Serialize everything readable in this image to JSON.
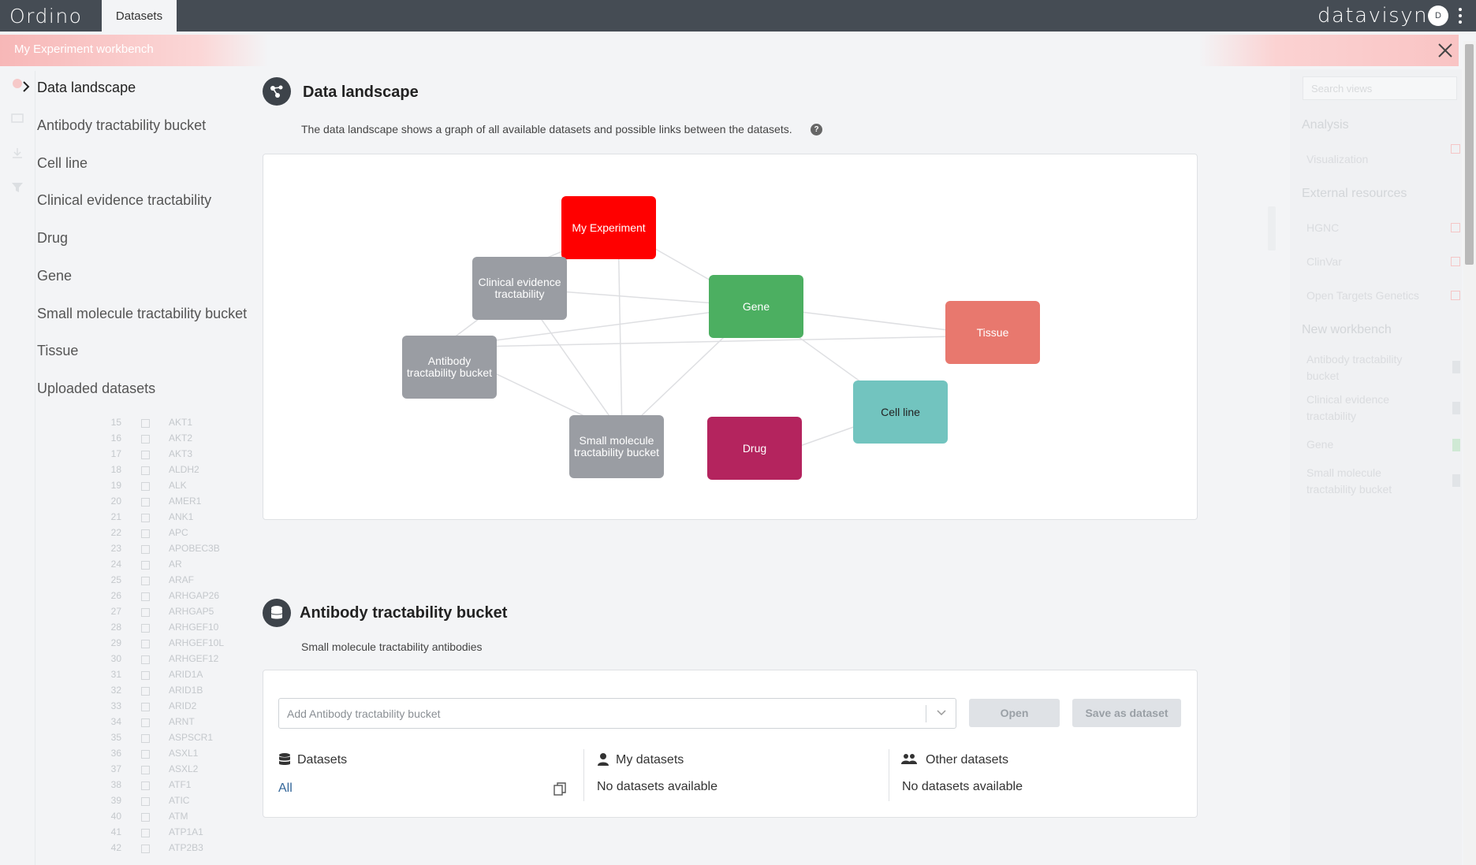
{
  "topbar": {
    "logo": "Ordino",
    "tab": "Datasets",
    "brand": "datavisyn",
    "avatar": "D"
  },
  "workbench": {
    "title": "My Experiment workbench"
  },
  "nav": {
    "items": [
      {
        "label": "Data landscape",
        "active": true
      },
      {
        "label": "Antibody tractability bucket"
      },
      {
        "label": "Cell line"
      },
      {
        "label": "Clinical evidence tractability"
      },
      {
        "label": "Drug"
      },
      {
        "label": "Gene"
      },
      {
        "label": "Small molecule tractability bucket"
      },
      {
        "label": "Tissue"
      },
      {
        "label": "Uploaded datasets"
      }
    ]
  },
  "background_rows": [
    {
      "num": "15",
      "sym": "AKT1"
    },
    {
      "num": "16",
      "sym": "AKT2"
    },
    {
      "num": "17",
      "sym": "AKT3"
    },
    {
      "num": "18",
      "sym": "ALDH2"
    },
    {
      "num": "19",
      "sym": "ALK"
    },
    {
      "num": "20",
      "sym": "AMER1"
    },
    {
      "num": "21",
      "sym": "ANK1"
    },
    {
      "num": "22",
      "sym": "APC"
    },
    {
      "num": "23",
      "sym": "APOBEC3B"
    },
    {
      "num": "24",
      "sym": "AR"
    },
    {
      "num": "25",
      "sym": "ARAF"
    },
    {
      "num": "26",
      "sym": "ARHGAP26"
    },
    {
      "num": "27",
      "sym": "ARHGAP5"
    },
    {
      "num": "28",
      "sym": "ARHGEF10"
    },
    {
      "num": "29",
      "sym": "ARHGEF10L"
    },
    {
      "num": "30",
      "sym": "ARHGEF12"
    },
    {
      "num": "31",
      "sym": "ARID1A"
    },
    {
      "num": "32",
      "sym": "ARID1B"
    },
    {
      "num": "33",
      "sym": "ARID2"
    },
    {
      "num": "34",
      "sym": "ARNT"
    },
    {
      "num": "35",
      "sym": "ASPSCR1"
    },
    {
      "num": "36",
      "sym": "ASXL1"
    },
    {
      "num": "37",
      "sym": "ASXL2"
    },
    {
      "num": "38",
      "sym": "ATF1"
    },
    {
      "num": "39",
      "sym": "ATIC"
    },
    {
      "num": "40",
      "sym": "ATM"
    },
    {
      "num": "41",
      "sym": "ATP1A1"
    },
    {
      "num": "42",
      "sym": "ATP2B3"
    }
  ],
  "right_panel": {
    "search_placeholder": "Search views",
    "analysis": "Analysis",
    "visualization": "Visualization",
    "external_resources": "External resources",
    "hgnc": "HGNC",
    "clinvar": "ClinVar",
    "open_targets": "Open Targets Genetics",
    "new_workbench": "New workbench",
    "nw_items": [
      "Antibody tractability bucket",
      "Clinical evidence tractability",
      "Gene",
      "Small molecule tractability bucket"
    ]
  },
  "landscape": {
    "title": "Data landscape",
    "description": "The data landscape shows a graph of all available datasets and possible links between the datasets.",
    "help": "?",
    "nodes": {
      "my_experiment": {
        "label": "My Experiment",
        "color": "#ff0000"
      },
      "clinical": {
        "label": "Clinical evidence tractability",
        "color": "#9a9da3"
      },
      "gene": {
        "label": "Gene",
        "color": "#4caf61"
      },
      "tissue": {
        "label": "Tissue",
        "color": "#e8786e"
      },
      "antibody": {
        "label": "Antibody tractability bucket",
        "color": "#9a9da3"
      },
      "cell_line": {
        "label": "Cell line",
        "color": "#72c4bf"
      },
      "small_molecule": {
        "label": "Small molecule tractability bucket",
        "color": "#9a9da3"
      },
      "drug": {
        "label": "Drug",
        "color": "#b4245e"
      }
    }
  },
  "bucket": {
    "title": "Antibody tractability bucket",
    "description": "Small molecule tractability antibodies",
    "select_placeholder": "Add Antibody tractability bucket",
    "open_label": "Open",
    "save_label": "Save as dataset",
    "datasets_header": "Datasets",
    "all_link": "All",
    "my_datasets_header": "My datasets",
    "my_datasets_value": "No datasets available",
    "other_datasets_header": "Other datasets",
    "other_datasets_value": "No datasets available"
  }
}
